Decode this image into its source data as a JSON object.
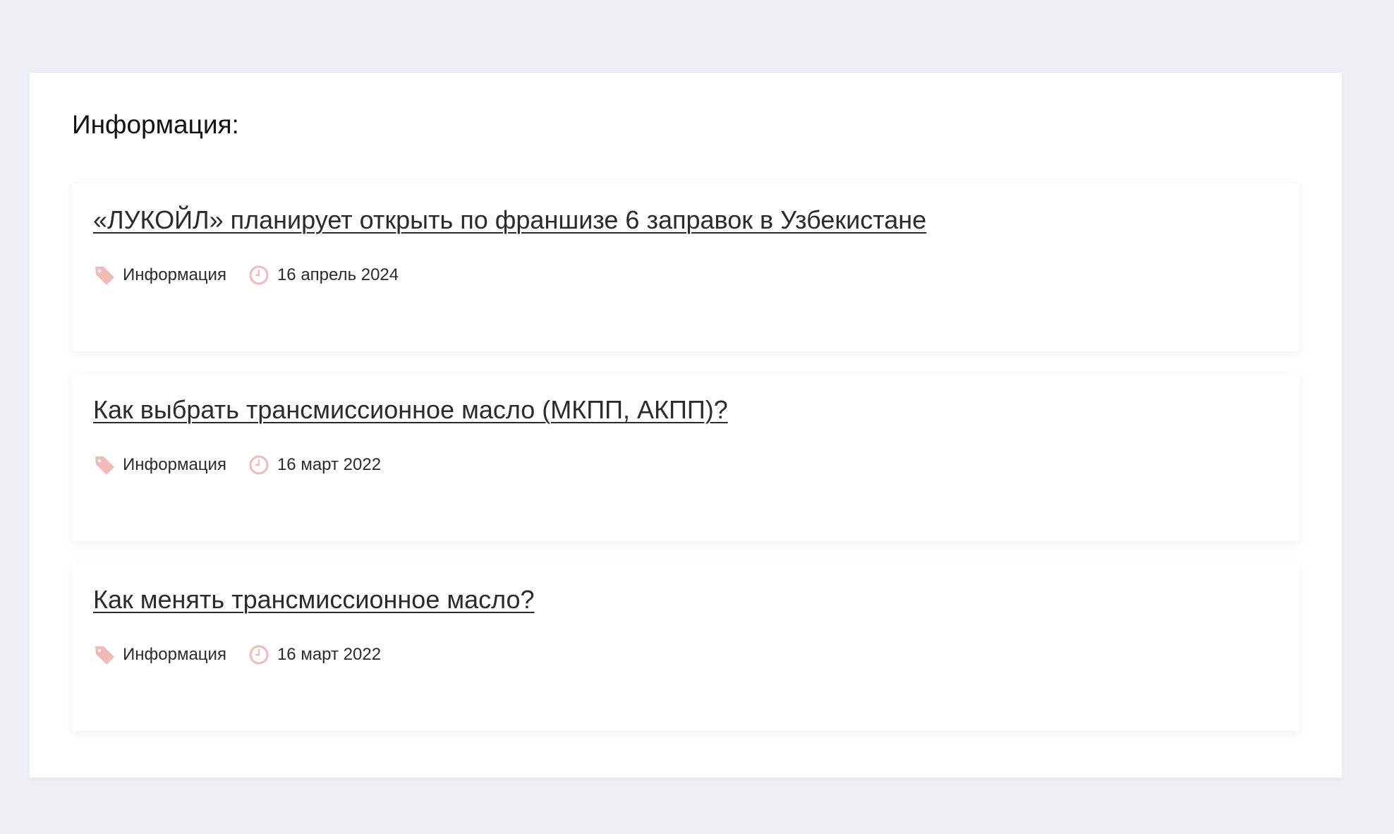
{
  "section": {
    "title": "Информация:"
  },
  "colors": {
    "accent_icon": "#f2b9b5",
    "text": "#2b2b2b",
    "background": "#ecf0f4"
  },
  "icons": {
    "tag": "tag-icon",
    "clock": "clock-icon"
  },
  "articles": [
    {
      "title": "«ЛУКОЙЛ» планирует открыть по франшизе 6 заправок в Узбекистане",
      "category": "Информация",
      "date": "16 апрель 2024"
    },
    {
      "title": "Как выбрать трансмиссионное масло (МКПП, АКПП)?",
      "category": "Информация",
      "date": "16 март 2022"
    },
    {
      "title": "Как менять трансмиссионное масло?",
      "category": "Информация",
      "date": "16 март 2022"
    }
  ]
}
